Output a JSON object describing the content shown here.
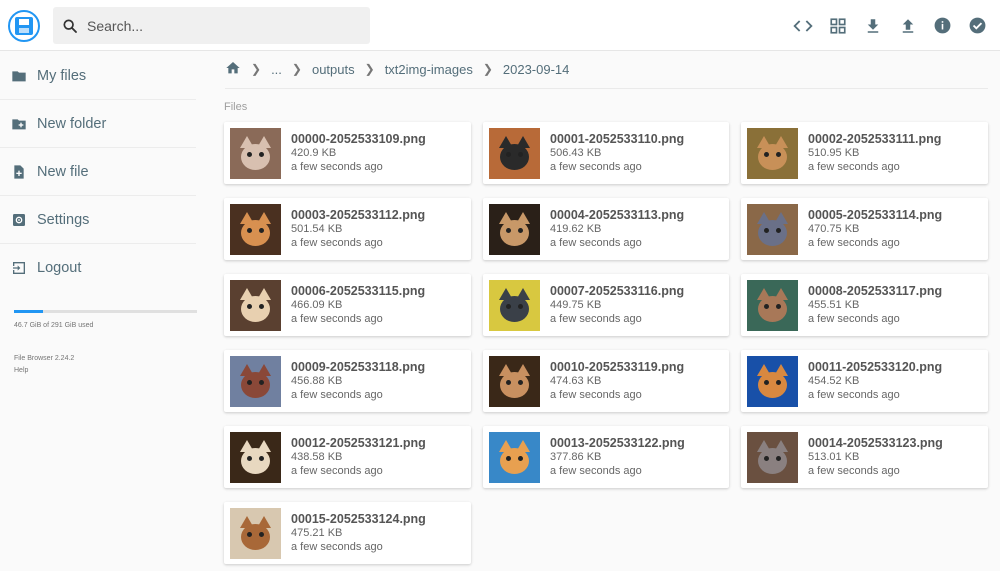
{
  "header": {
    "search_placeholder": "Search..."
  },
  "sidebar": {
    "items": [
      {
        "label": "My files",
        "icon": "folder-icon"
      },
      {
        "label": "New folder",
        "icon": "create-new-folder-icon"
      },
      {
        "label": "New file",
        "icon": "note-add-icon"
      },
      {
        "label": "Settings",
        "icon": "settings-icon"
      },
      {
        "label": "Logout",
        "icon": "exit-icon"
      }
    ],
    "storage_text": "46.7 GiB of 291 GiB used",
    "storage_fraction": 0.16,
    "app_version": "File Browser 2.24.2",
    "help_label": "Help"
  },
  "breadcrumb": {
    "items": [
      "...",
      "outputs",
      "txt2img-images",
      "2023-09-14"
    ]
  },
  "section_title": "Files",
  "files": [
    {
      "name": "00000-2052533109.png",
      "size": "420.9 KB",
      "modified": "a few seconds ago",
      "bg": "#8a6a58",
      "fur": "#d8c0b0"
    },
    {
      "name": "00001-2052533110.png",
      "size": "506.43 KB",
      "modified": "a few seconds ago",
      "bg": "#b86a38",
      "fur": "#2a2a2a"
    },
    {
      "name": "00002-2052533111.png",
      "size": "510.95 KB",
      "modified": "a few seconds ago",
      "bg": "#8a7038",
      "fur": "#c89058"
    },
    {
      "name": "00003-2052533112.png",
      "size": "501.54 KB",
      "modified": "a few seconds ago",
      "bg": "#4a3020",
      "fur": "#d89050"
    },
    {
      "name": "00004-2052533113.png",
      "size": "419.62 KB",
      "modified": "a few seconds ago",
      "bg": "#2a2018",
      "fur": "#c89868"
    },
    {
      "name": "00005-2052533114.png",
      "size": "470.75 KB",
      "modified": "a few seconds ago",
      "bg": "#8a6848",
      "fur": "#6a7088"
    },
    {
      "name": "00006-2052533115.png",
      "size": "466.09 KB",
      "modified": "a few seconds ago",
      "bg": "#5a4030",
      "fur": "#e8d0b0"
    },
    {
      "name": "00007-2052533116.png",
      "size": "449.75 KB",
      "modified": "a few seconds ago",
      "bg": "#d8c840",
      "fur": "#3a4048"
    },
    {
      "name": "00008-2052533117.png",
      "size": "455.51 KB",
      "modified": "a few seconds ago",
      "bg": "#3a6858",
      "fur": "#a87858"
    },
    {
      "name": "00009-2052533118.png",
      "size": "456.88 KB",
      "modified": "a few seconds ago",
      "bg": "#7080a0",
      "fur": "#8a4838"
    },
    {
      "name": "00010-2052533119.png",
      "size": "474.63 KB",
      "modified": "a few seconds ago",
      "bg": "#3a2818",
      "fur": "#c89060"
    },
    {
      "name": "00011-2052533120.png",
      "size": "454.52 KB",
      "modified": "a few seconds ago",
      "bg": "#1850a8",
      "fur": "#d88840"
    },
    {
      "name": "00012-2052533121.png",
      "size": "438.58 KB",
      "modified": "a few seconds ago",
      "bg": "#3a2818",
      "fur": "#e8d8c0"
    },
    {
      "name": "00013-2052533122.png",
      "size": "377.86 KB",
      "modified": "a few seconds ago",
      "bg": "#3888c8",
      "fur": "#e8a050"
    },
    {
      "name": "00014-2052533123.png",
      "size": "513.01 KB",
      "modified": "a few seconds ago",
      "bg": "#6a5040",
      "fur": "#8a8080"
    },
    {
      "name": "00015-2052533124.png",
      "size": "475.21 KB",
      "modified": "a few seconds ago",
      "bg": "#d8c8b0",
      "fur": "#a86838"
    }
  ]
}
